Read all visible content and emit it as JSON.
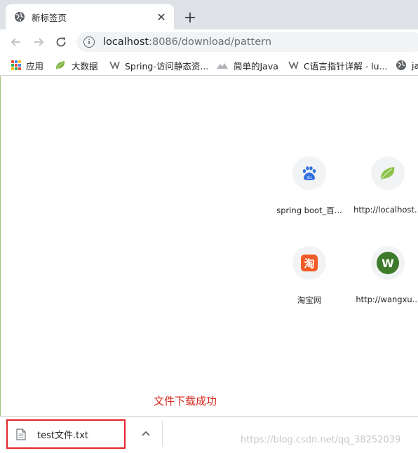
{
  "tab": {
    "title": "新标签页",
    "close_glyph": "✕",
    "favicon": "globe-icon"
  },
  "new_tab": {
    "glyph": "+"
  },
  "omnibox": {
    "host": "localhost",
    "rest": ":8086/download/pattern"
  },
  "bookmarks": [
    {
      "label": "应用",
      "icon": "apps-grid-icon"
    },
    {
      "label": "大数据",
      "icon": "spring-leaf-icon"
    },
    {
      "label": "Spring-访问静态资...",
      "icon": "csdn-icon"
    },
    {
      "label": "简单的Java",
      "icon": "mountain-icon"
    },
    {
      "label": "C语言指针详解 - lu...",
      "icon": "csdn-icon"
    },
    {
      "label": "ja",
      "icon": "globe-icon"
    }
  ],
  "tiles": [
    {
      "label": "spring boot_百...",
      "icon": "baidu-icon"
    },
    {
      "label": "http://localhost...",
      "icon": "spring-leaf-icon"
    },
    {
      "label": "淘宝网",
      "icon": "taobao-icon",
      "glyph": "淘"
    },
    {
      "label": "http://wangxu...",
      "icon": "w-letter-icon",
      "glyph": "W"
    }
  ],
  "status_message": "文件下载成功",
  "download": {
    "filename": "test文件.txt",
    "icon": "file-icon",
    "chevron": "chevron-up-icon"
  },
  "watermark": "https://blog.csdn.net/qq_38252039",
  "colors": {
    "accent_red": "#d4251c",
    "tile_bg": "#f1f3f4",
    "w_green": "#3d7a2a",
    "taobao_orange": "#f15a24"
  }
}
